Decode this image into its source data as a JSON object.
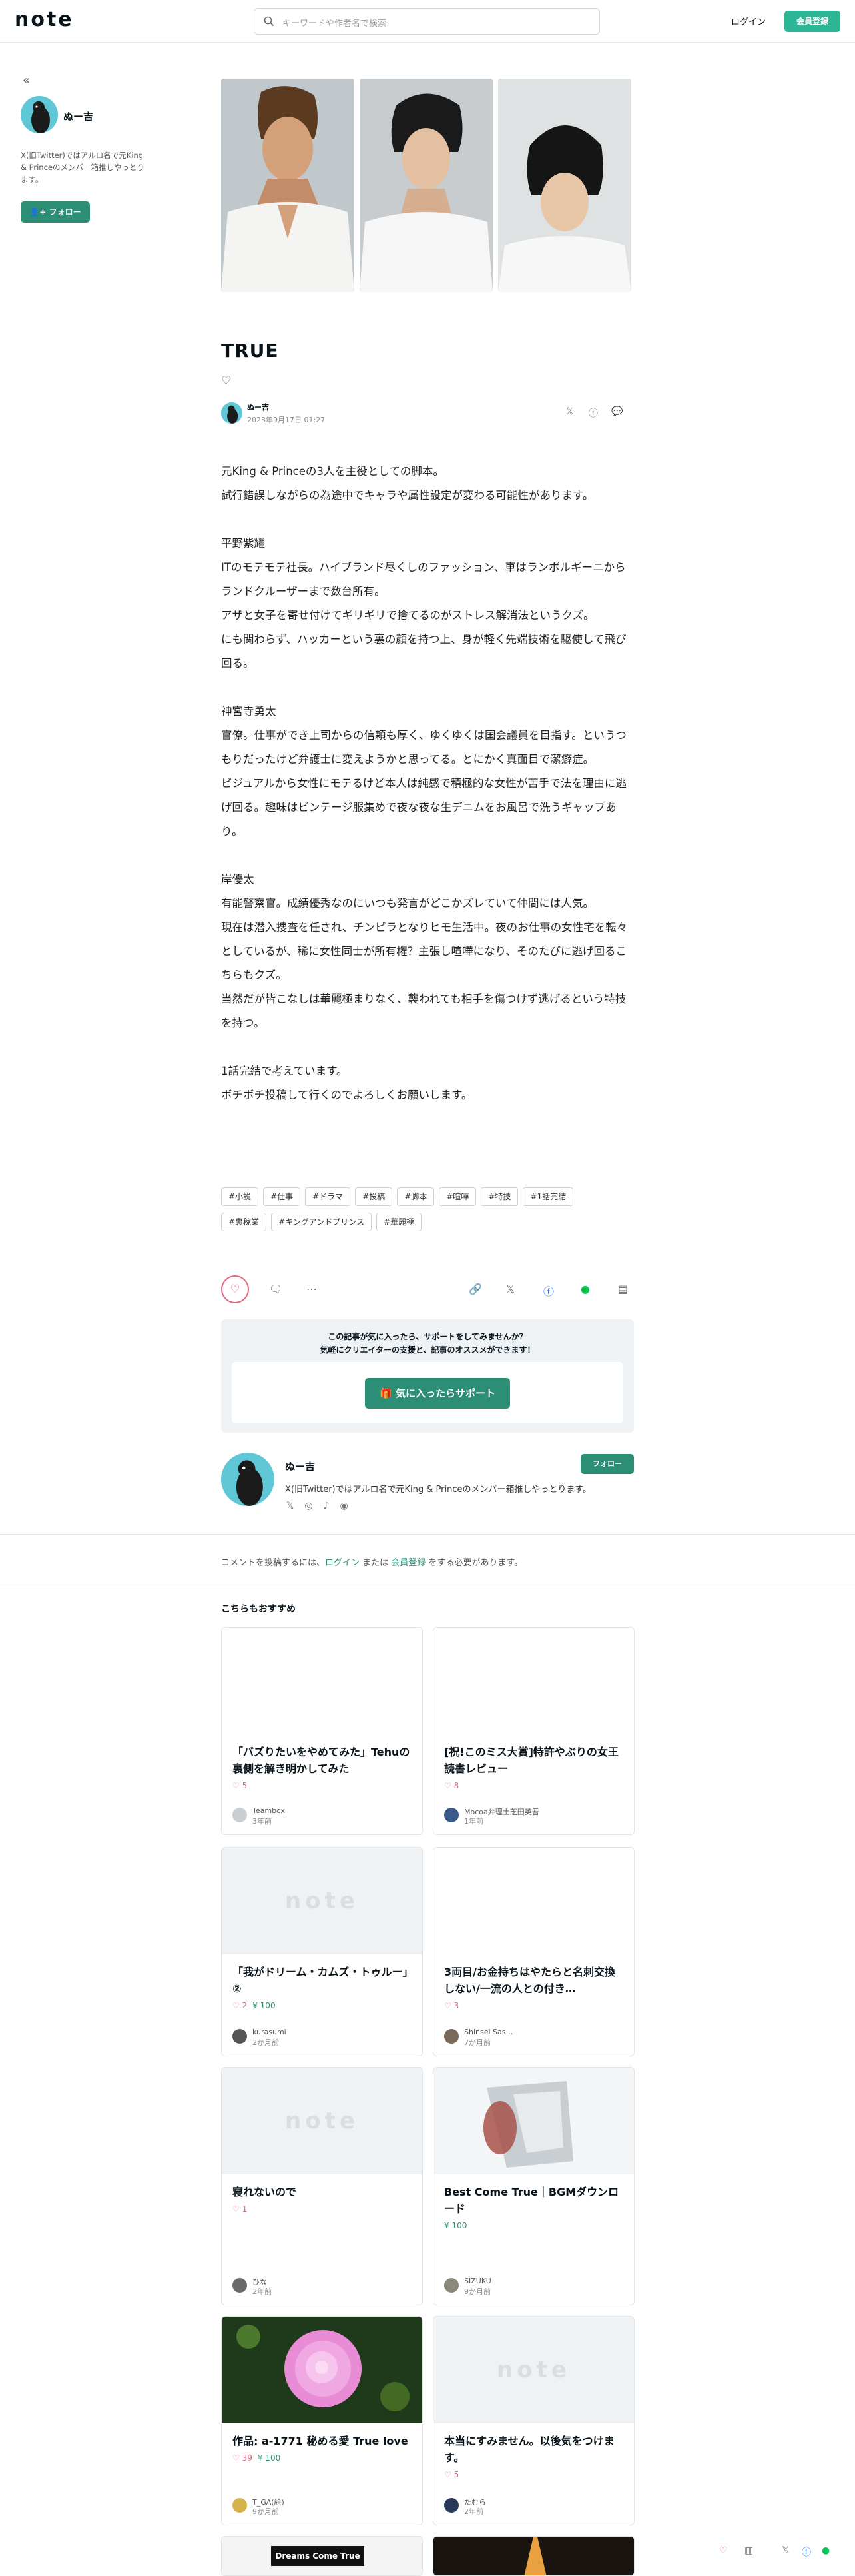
{
  "header": {
    "logo": "note",
    "search_placeholder": "キーワードや作者名で検索",
    "login": "ログイン",
    "signup": "会員登録"
  },
  "sidebar": {
    "collapse": "«",
    "author_name": "ぬー吉",
    "bio": "X(旧Twitter)ではアルロ名で元King & Princeのメンバー箱推しやっとります。",
    "follow": "フォロー"
  },
  "article": {
    "title": "TRUE",
    "author_name": "ぬー吉",
    "date": "2023年9月17日 01:27",
    "paragraphs": [
      "元King & Princeの3人を主役としての脚本。",
      "試行錯誤しながらの為途中でキャラや属性設定が変わる可能性があります。",
      "",
      "平野紫耀",
      "ITのモテモテ社長。ハイブランド尽くしのファッション、車はランボルギーニからランドクルーザーまで数台所有。",
      "アザと女子を寄せ付けてギリギリで捨てるのがストレス解消法というクズ。",
      "にも関わらず、ハッカーという裏の顔を持つ上、身が軽く先端技術を駆使して飛び回る。",
      "",
      "神宮寺勇太",
      "官僚。仕事ができ上司からの信頼も厚く、ゆくゆくは国会議員を目指す。というつもりだったけど弁護士に変えようかと思ってる。とにかく真面目で潔癖症。",
      "ビジュアルから女性にモテるけど本人は純感で積極的な女性が苦手で法を理由に逃げ回る。趣味はビンテージ服集めで夜な夜な生デニムをお風呂で洗うギャップあり。",
      "",
      "岸優太",
      "有能警察官。成績優秀なのにいつも発言がどこかズレていて仲間には人気。",
      "現在は潜入捜査を任され、チンピラとなりヒモ生活中。夜のお仕事の女性宅を転々としているが、稀に女性同士が所有権？主張し喧嘩になり、そのたびに逃げ回るこちらもクズ。",
      "当然だが皆こなしは華麗極まりなく、襲われても相手を傷つけず逃げるという特技を持つ。",
      "",
      "1話完結で考えています。",
      "ボチボチ投稿して行くのでよろしくお願いします。"
    ],
    "tags": [
      "#小説",
      "#仕事",
      "#ドラマ",
      "#投稿",
      "#脚本",
      "#喧嘩",
      "#特技",
      "#1話完結",
      "#裏稼業",
      "#キングアンドプリンス",
      "#華麗極"
    ]
  },
  "support": {
    "message_line1": "この記事が気に入ったら、サポートをしてみませんか？",
    "message_line2": "気軽にクリエイターの支援と、記事のオススメができます！",
    "button": "気に入ったらサポート"
  },
  "profile": {
    "name": "ぬー吉",
    "follow": "フォロー",
    "bio": "X(旧Twitter)ではアルロ名で元King & Princeのメンバー箱推しやっとります。"
  },
  "comments": {
    "prefix": "コメントを投稿するには、",
    "login": "ログイン",
    "middle": " または ",
    "signup": "会員登録",
    "suffix": " をする必要があります。"
  },
  "recommend": {
    "heading": "こちらもおすすめ",
    "placeholder_logo": "note",
    "cards": [
      {
        "title": "「バズりたいをやめてみた」Tehuの裏側を解き明かしてみた",
        "likes": "5",
        "price": "",
        "author": "Teambox",
        "time": "3年前"
      },
      {
        "title": "[祝!このミス大賞]特許やぶりの女王　読書レビュー",
        "likes": "8",
        "price": "",
        "author": "Mocoa弁理士芝田英吾",
        "time": "1年前"
      },
      {
        "title": "「我がドリーム・カムズ・トゥルー」②",
        "likes": "2",
        "price": "100",
        "author": "kurasumi",
        "time": "2か月前"
      },
      {
        "title": "3両目/お金持ちはやたらと名刺交換しない/一流の人との付き…",
        "likes": "3",
        "price": "",
        "author": "Shinsei Sas…",
        "time": "7か月前"
      },
      {
        "title": "寝れないので",
        "likes": "1",
        "price": "",
        "author": "ひな",
        "time": "2年前"
      },
      {
        "title": "Best Come True｜BGMダウンロード",
        "likes": "",
        "price": "100",
        "author": "SIZUKU",
        "time": "9か月前"
      },
      {
        "title": "作品: a-1771 秘める愛 True love",
        "likes": "39",
        "price": "100",
        "author": "T_GA(絵)",
        "time": "9か月前"
      },
      {
        "title": "本当にすみません。以後気をつけます。",
        "likes": "5",
        "price": "",
        "author": "たむら",
        "time": "2年前"
      }
    ],
    "bottom_card_text": "Dreams Come True"
  }
}
